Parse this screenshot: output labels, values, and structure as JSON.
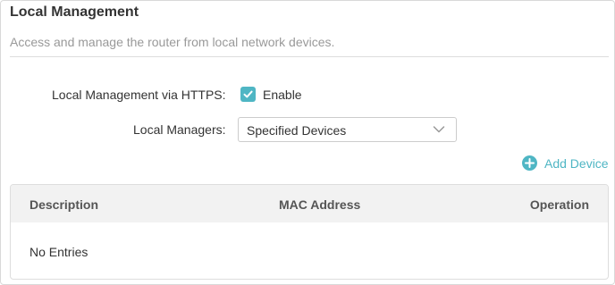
{
  "section": {
    "title": "Local Management",
    "subtitle": "Access and manage the router from local network devices."
  },
  "https": {
    "label": "Local Management via HTTPS:",
    "checkbox_label": "Enable",
    "checked": true
  },
  "managers": {
    "label": "Local Managers:",
    "selected": "Specified Devices"
  },
  "add_device": {
    "label": "Add Device"
  },
  "table": {
    "columns": [
      "Description",
      "MAC Address",
      "Operation"
    ],
    "empty_text": "No Entries"
  },
  "colors": {
    "accent": "#4fb6c4",
    "header_bg": "#f2f2f2",
    "muted_text": "#999999"
  },
  "icons": {
    "checkbox": "check-icon",
    "dropdown": "chevron-down-icon",
    "add": "plus-circle-icon"
  }
}
